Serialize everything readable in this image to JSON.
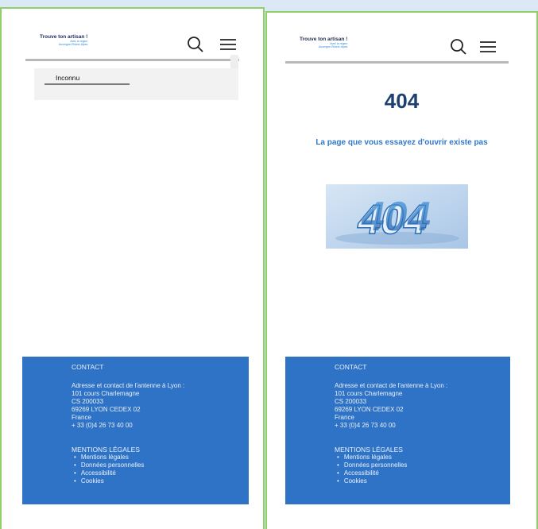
{
  "brand": {
    "title": "Trouve ton artisan !",
    "subtitle_line1": "Avec la région",
    "subtitle_line2": "Auvergne-Rhône-Alpes"
  },
  "icons": {
    "search": "search-icon",
    "menu": "hamburger-menu-icon"
  },
  "left_page": {
    "unknown_label": "Inconnu"
  },
  "right_page": {
    "error_code": "404",
    "error_message": "La page que vous essayez d'ouvrir existe pas",
    "error_image_text": "404"
  },
  "footer": {
    "contact_title": "CONTACT",
    "address_lines": [
      "Adresse et contact de l'antenne à Lyon :",
      "101 cours Charlemagne",
      "CS 200033",
      "69269 LYON CEDEX 02",
      "France",
      "+ 33 (0)4 26 73 40 00"
    ],
    "legal_title": "MENTIONS LÉGALES",
    "legal_links": [
      "Mentions légales",
      "Données personnelles",
      "Accessibilité",
      "Cookies"
    ]
  },
  "colors": {
    "background": "#dbe8f6",
    "frame_border": "#8fd06a",
    "footer_bg": "#2f73c6",
    "error_code": "#1d3f73",
    "error_message": "#3278c7"
  }
}
